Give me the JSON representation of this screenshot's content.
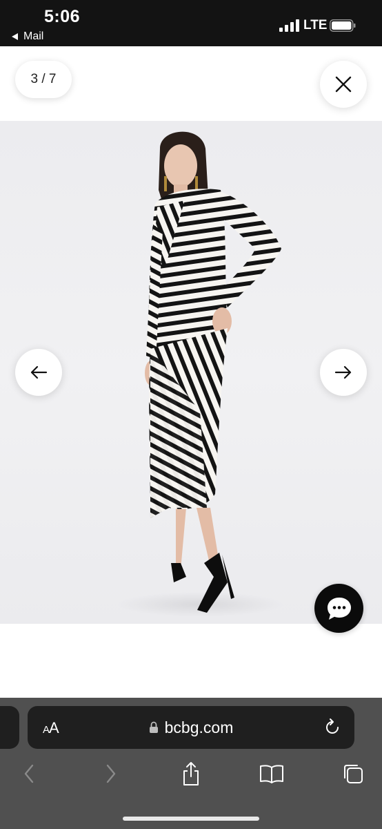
{
  "status_bar": {
    "time": "5:06",
    "back_label": "Mail",
    "network": "LTE",
    "icons": [
      "signal-icon",
      "battery-icon"
    ]
  },
  "gallery": {
    "counter": "3 / 7",
    "icons": {
      "close": "close-icon",
      "previous": "arrow-left-icon",
      "next": "arrow-right-icon",
      "chat": "chat-bubble-icon"
    },
    "image_subject": "striped-dress-photo"
  },
  "browser": {
    "text_size_label_small": "A",
    "text_size_label_large": "A",
    "url": "bcbg.com",
    "icons": {
      "lock": "lock-icon",
      "reload": "reload-icon",
      "back": "chevron-left-icon",
      "forward": "chevron-right-icon",
      "share": "share-icon",
      "bookmarks": "book-icon",
      "tabs": "tabs-icon"
    }
  },
  "colors": {
    "status_bar": "#131313",
    "browser_toolbar": "#505050",
    "address_bar": "#1f1f1f",
    "chat_button": "#0b0b0b",
    "photo_background": "#eeeef0"
  }
}
